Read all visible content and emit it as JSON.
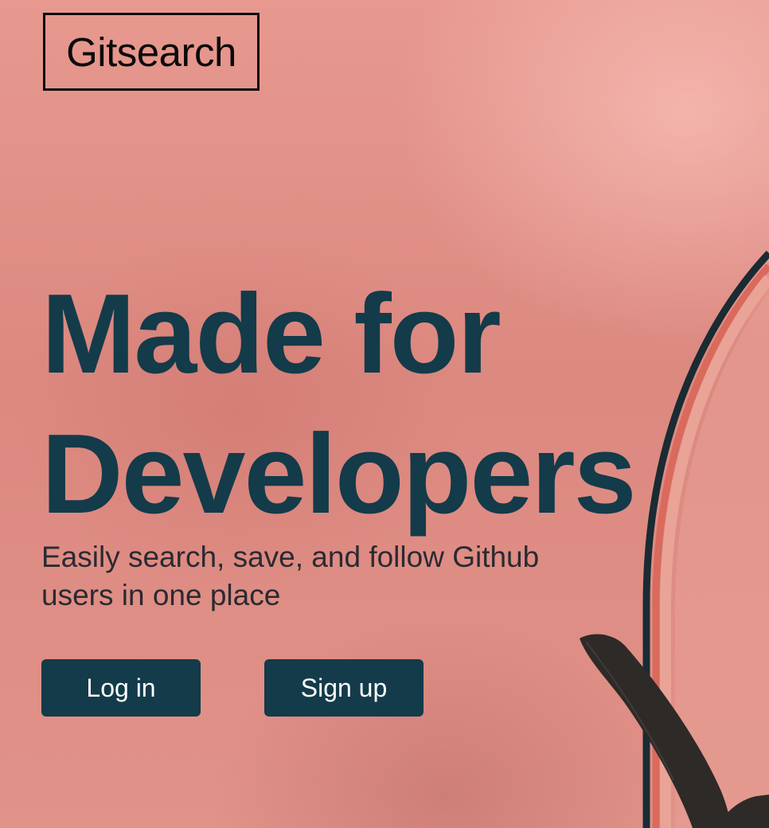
{
  "brand": {
    "logo_text": "Gitsearch"
  },
  "hero": {
    "headline_line1": "Made for",
    "headline_line2": "Developers",
    "subtitle": "Easily search, save, and follow Github users in one place"
  },
  "actions": {
    "login_label": "Log in",
    "signup_label": "Sign up"
  },
  "colors": {
    "background": "#e08f86",
    "primary": "#133b4a",
    "headline": "#133b4a",
    "subtitle": "#2a2a32",
    "button_text": "#ffffff",
    "logo_border": "#0b0b0b"
  },
  "background_art": {
    "description_icon": "mirror-arch-and-plant-leaf-illustration"
  }
}
